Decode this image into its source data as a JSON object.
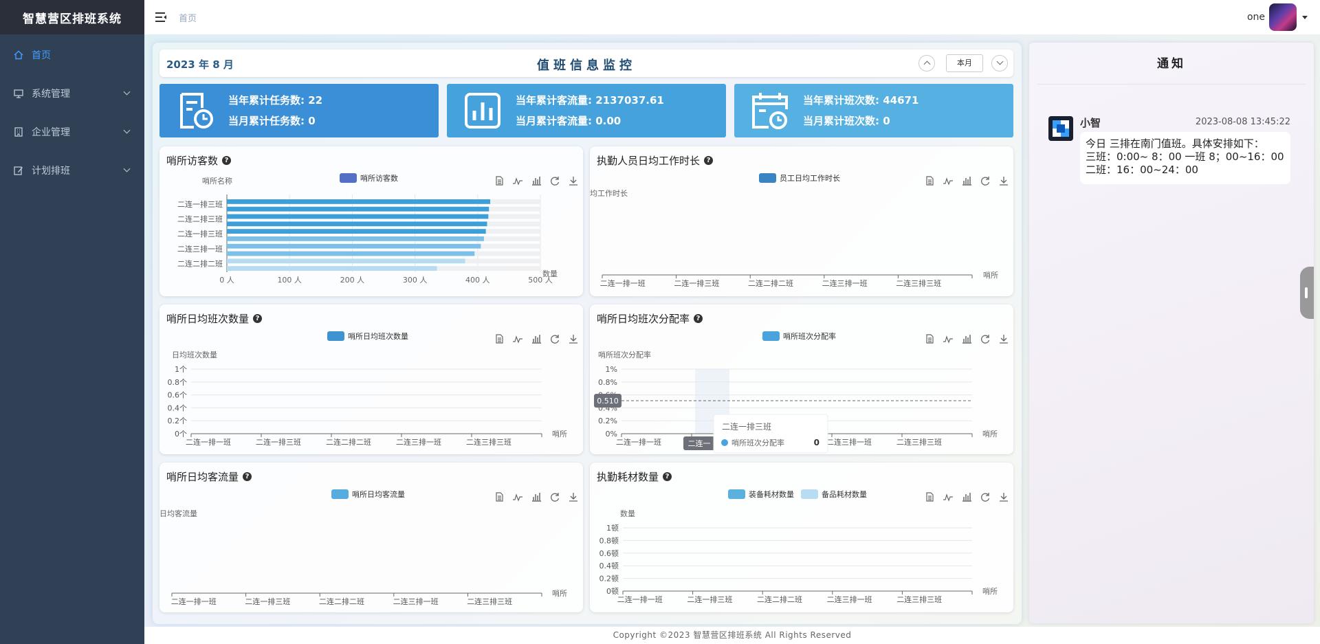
{
  "app": {
    "title": "智慧营区排班系统",
    "copyright": "Copyright ©2023 智慧营区排班系统 All Rights Reserved"
  },
  "sidebar": {
    "items": [
      {
        "label": "首页",
        "icon": "home-icon",
        "active": true
      },
      {
        "label": "系统管理",
        "icon": "monitor-icon"
      },
      {
        "label": "企业管理",
        "icon": "building-icon"
      },
      {
        "label": "计划排班",
        "icon": "edit-icon"
      }
    ]
  },
  "topbar": {
    "breadcrumb": "首页",
    "user": "one"
  },
  "board": {
    "date": "2023 年 8 月",
    "title": "值班信息监控",
    "month_btn": "本月",
    "stats": [
      {
        "line1": "当年累计任务数: 22",
        "line2": "当月累计任务数: 0",
        "color": "#3a8fd6"
      },
      {
        "line1": "当年累计客流量: 2137037.61",
        "line2": "当月累计客流量: 0.00",
        "color": "#45a2dd"
      },
      {
        "line1": "当年累计班次数: 44671",
        "line2": "当月累计班次数: 0",
        "color": "#56b0e2"
      }
    ]
  },
  "cards": {
    "c1": {
      "title": "哨所访客数",
      "legend": "哨所访客数",
      "ylabel": "哨所名称",
      "xlabel": "数量"
    },
    "c2": {
      "title": "执勤人员日均工作时长",
      "legend": "员工日均工作时长",
      "ylabel": "均工作时长",
      "xlabel": "哨所"
    },
    "c3": {
      "title": "哨所日均班次数量",
      "legend": "哨所日均班次数量",
      "ylabel": "日均班次数量",
      "xlabel": "哨所"
    },
    "c4": {
      "title": "哨所日均班次分配率",
      "legend": "哨所班次分配率",
      "ylabel": "哨所班次分配率",
      "xlabel": "哨所",
      "pointer_value": "0.510",
      "tooltip_title": "二连一排三班",
      "tooltip_series": "哨所班次分配率",
      "tooltip_value": "0",
      "axis_pointer_label": "二连一"
    },
    "c5": {
      "title": "哨所日均客流量",
      "legend": "哨所日均客流量",
      "ylabel": "日均客流量",
      "xlabel": "哨所"
    },
    "c6": {
      "title": "执勤耗材数量",
      "legend": "装备耗材数量",
      "legend2": "备品耗材数量",
      "ylabel": "数量",
      "xlabel": "哨所"
    }
  },
  "chart_data": [
    {
      "type": "bar",
      "orientation": "horizontal",
      "title": "哨所访客数",
      "ylabel": "哨所名称",
      "xlabel": "数量",
      "categories": [
        "二连一排三班",
        "二连二排三班",
        "二连一排三班",
        "二连三排一班",
        "二连二排二班"
      ],
      "values": [
        420,
        418,
        417,
        415,
        413,
        410,
        405,
        395,
        380,
        335
      ],
      "xticks": [
        "0 人",
        "100 人",
        "200 人",
        "300 人",
        "400 人",
        "500 人"
      ],
      "xlim": [
        0,
        500
      ]
    },
    {
      "type": "line",
      "title": "执勤人员日均工作时长",
      "series": [
        {
          "name": "员工日均工作时长",
          "values": []
        }
      ],
      "categories": [
        "二连一排一班",
        "二连一排三班",
        "二连二排二班",
        "二连三排一班",
        "二连三排三班"
      ]
    },
    {
      "type": "bar",
      "title": "哨所日均班次数量",
      "series": [
        {
          "name": "哨所日均班次数量",
          "values": []
        }
      ],
      "categories": [
        "二连一排一班",
        "二连一排三班",
        "二连二排二班",
        "二连三排一班",
        "二连三排三班"
      ],
      "yticks": [
        "0个",
        "0.2个",
        "0.4个",
        "0.6个",
        "0.8个",
        "1个"
      ],
      "ylim": [
        0,
        1
      ]
    },
    {
      "type": "bar",
      "title": "哨所日均班次分配率",
      "series": [
        {
          "name": "哨所班次分配率",
          "values": []
        }
      ],
      "categories": [
        "二连一排一班",
        "二连一排三班",
        "二连二排二班",
        "二连三排一班",
        "二连三排三班"
      ],
      "yticks": [
        "0%",
        "0.2%",
        "0.4%",
        "0.6%",
        "0.8%",
        "1%"
      ],
      "ylim": [
        0,
        1
      ]
    },
    {
      "type": "line",
      "title": "哨所日均客流量",
      "series": [
        {
          "name": "哨所日均客流量",
          "values": []
        }
      ],
      "categories": [
        "二连一排一班",
        "二连一排三班",
        "二连二排二班",
        "二连三排一班",
        "二连三排三班"
      ]
    },
    {
      "type": "bar",
      "title": "执勤耗材数量",
      "series": [
        {
          "name": "装备耗材数量",
          "values": []
        },
        {
          "name": "备品耗材数量",
          "values": []
        }
      ],
      "categories": [
        "二连一排一班",
        "二连一排三班",
        "二连二排二班",
        "二连三排一班",
        "二连三排三班"
      ],
      "yticks": [
        "0顿",
        "0.2顿",
        "0.4顿",
        "0.6顿",
        "0.8顿",
        "1顿"
      ],
      "ylim": [
        0,
        1
      ]
    }
  ],
  "notice": {
    "title": "通知",
    "sender": "小智",
    "time": "2023-08-08 13:45:22",
    "lines": [
      "今日 三排在南门值班。具体安排如下：",
      "三班：0:00~ 8：00 一班 8；00~16：00",
      "二班：16：00~24：00"
    ]
  }
}
